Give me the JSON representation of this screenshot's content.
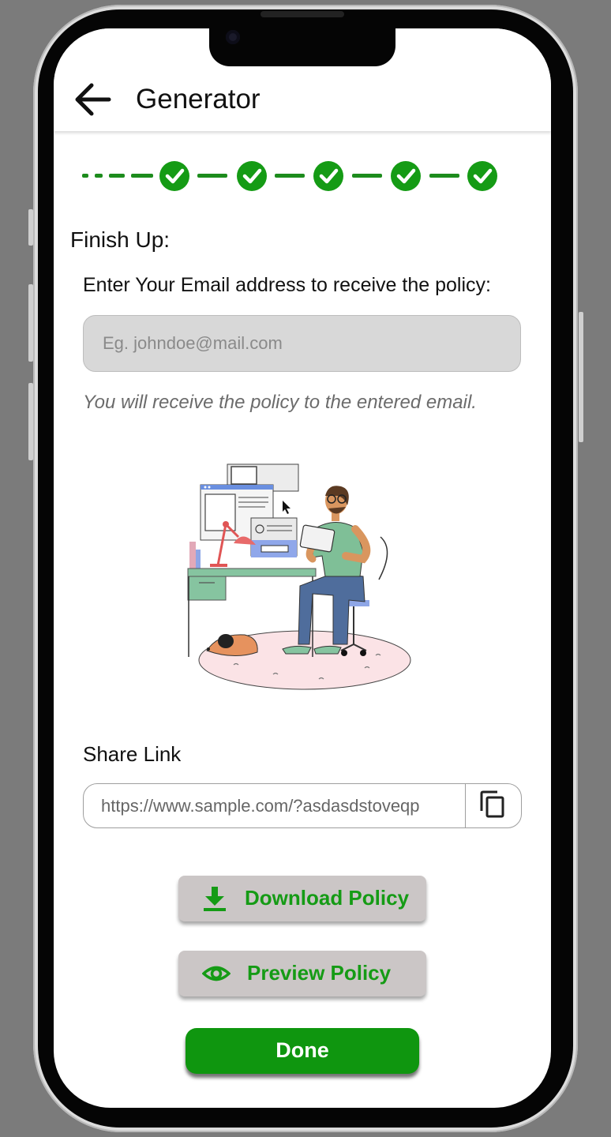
{
  "header": {
    "title": "Generator",
    "back_icon": "arrow-left-icon"
  },
  "stepper": {
    "completed_steps": 5,
    "accent_color": "#159b15"
  },
  "finish": {
    "section_title": "Finish Up:",
    "email_label": "Enter Your Email address to receive the policy:",
    "email_value": "",
    "email_placeholder": "Eg. johndoe@mail.com",
    "hint": "You will receive the policy to the entered email."
  },
  "share": {
    "label": "Share Link",
    "url": "https://www.sample.com/?asdasdstoveqp",
    "copy_icon": "copy-icon"
  },
  "actions": {
    "download_label": "Download Policy",
    "download_icon": "download-icon",
    "preview_label": "Preview Policy",
    "preview_icon": "eye-icon",
    "done_label": "Done"
  },
  "colors": {
    "primary_green": "#0f960f",
    "button_gray": "#cbc6c6"
  }
}
